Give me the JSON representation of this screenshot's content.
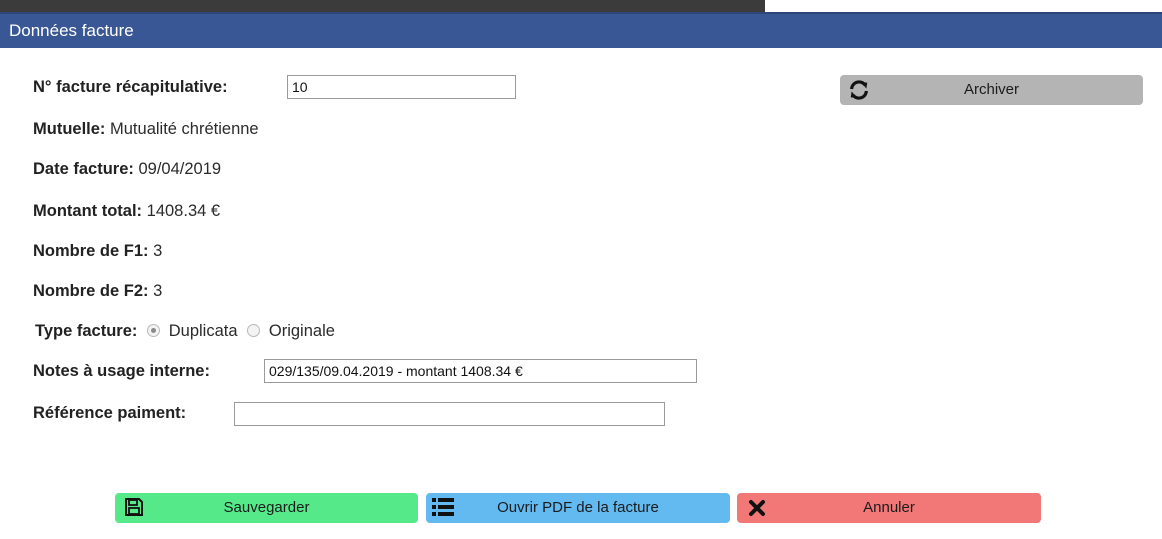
{
  "dialog": {
    "title": "Données facture"
  },
  "form": {
    "invoice_number_label": "N° facture récapitulative:",
    "invoice_number_value": "10",
    "mutuelle_label": "Mutuelle:",
    "mutuelle_value": "Mutualité chrétienne",
    "date_label": "Date facture:",
    "date_value": "09/04/2019",
    "amount_label": "Montant total:",
    "amount_value": "1408.34 €",
    "f1_label": "Nombre de F1:",
    "f1_value": "3",
    "f2_label": "Nombre de F2:",
    "f2_value": "3",
    "type_label": "Type facture:",
    "type_options": [
      "Duplicata",
      "Originale"
    ],
    "type_selected": "Duplicata",
    "notes_label": "Notes à usage interne:",
    "notes_value": "029/135/09.04.2019 - montant 1408.34 €",
    "payment_ref_label": "Référence paiment:",
    "payment_ref_value": ""
  },
  "buttons": {
    "archive": "Archiver",
    "save": "Sauvegarder",
    "open_pdf": "Ouvrir PDF de la facture",
    "cancel": "Annuler"
  },
  "icons": {
    "archive": "refresh-icon",
    "save": "floppy-disk-icon",
    "open_pdf": "list-icon",
    "cancel": "close-icon"
  },
  "colors": {
    "titlebar": "#3a5795",
    "archive_button": "#b4b4b4",
    "save_button": "#55e98a",
    "pdf_button": "#63baf0",
    "cancel_button": "#f27777"
  }
}
